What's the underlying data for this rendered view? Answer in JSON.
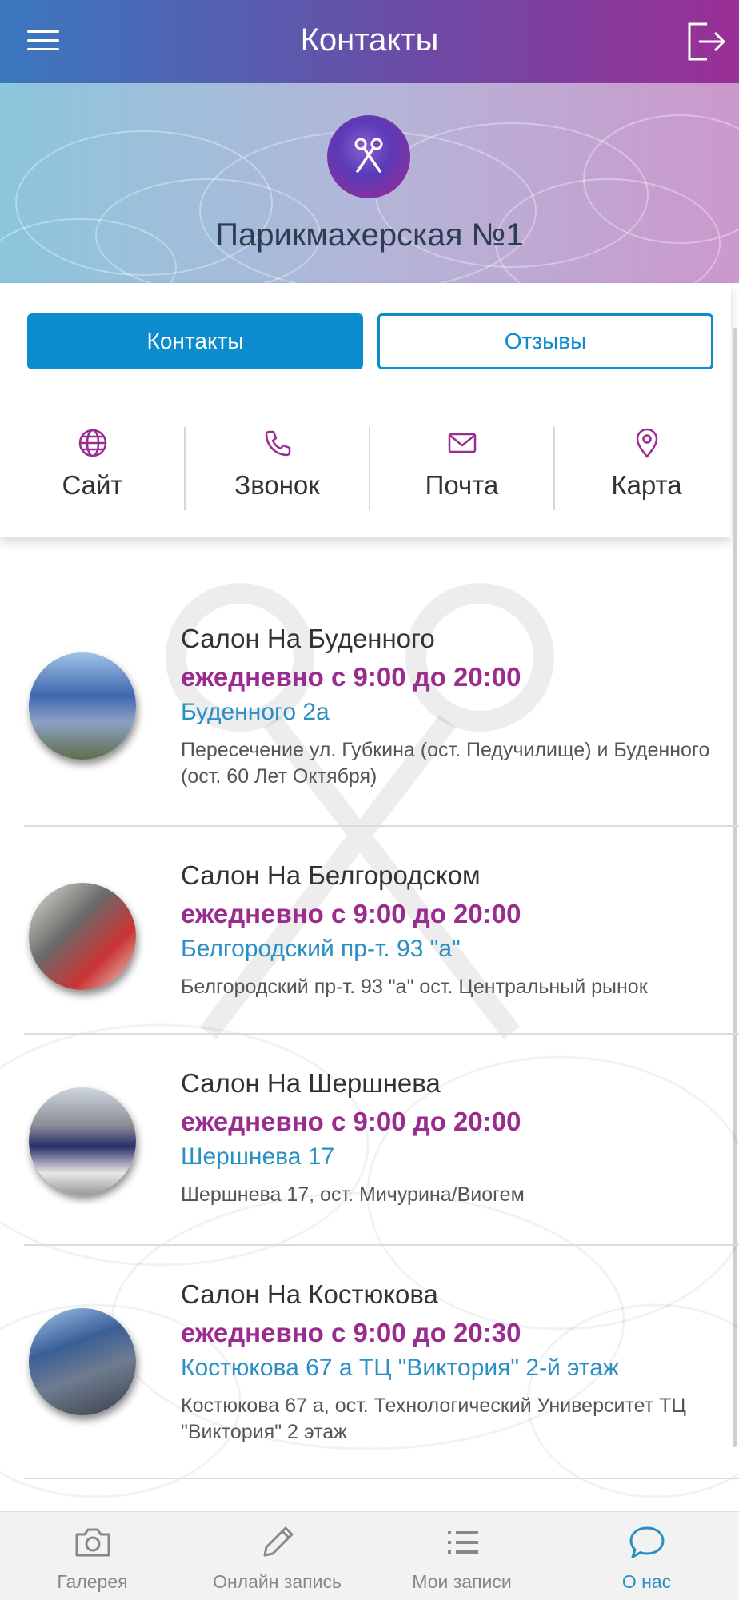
{
  "header": {
    "title": "Контакты"
  },
  "hero": {
    "name": "Парикмахерская №1"
  },
  "tabs": [
    {
      "label": "Контакты",
      "active": true
    },
    {
      "label": "Отзывы",
      "active": false
    }
  ],
  "actions": [
    {
      "label": "Сайт",
      "icon": "globe-icon"
    },
    {
      "label": "Звонок",
      "icon": "phone-icon"
    },
    {
      "label": "Почта",
      "icon": "mail-icon"
    },
    {
      "label": "Карта",
      "icon": "map-pin-icon"
    }
  ],
  "salons": [
    {
      "name": "Салон На Буденного",
      "hours": "ежедневно с 9:00 до 20:00",
      "address": "Буденного 2а",
      "description": "Пересечение ул. Губкина (ост. Педучилище) и Буденного (ост. 60 Лет Октября)"
    },
    {
      "name": "Салон На Белгородском",
      "hours": "ежедневно с 9:00 до 20:00",
      "address": "Белгородский пр-т. 93 \"а\"",
      "description": "Белгородский пр-т. 93 \"а\" ост. Центральный рынок"
    },
    {
      "name": "Салон На Шершнева",
      "hours": "ежедневно с 9:00 до 20:00",
      "address": "Шершнева 17",
      "description": "Шершнева 17, ост. Мичурина/Виогем"
    },
    {
      "name": "Салон На Костюкова",
      "hours": "ежедневно с 9:00 до 20:30",
      "address": "Костюкова 67 а ТЦ \"Виктория\" 2-й этаж",
      "description": "Костюкова 67 а, ост. Технологический Университет ТЦ \"Виктория\" 2 этаж"
    }
  ],
  "bottom_nav": [
    {
      "label": "Галерея",
      "icon": "camera-icon",
      "active": false
    },
    {
      "label": "Онлайн запись",
      "icon": "pencil-icon",
      "active": false
    },
    {
      "label": "Мои записи",
      "icon": "list-icon",
      "active": false
    },
    {
      "label": "О нас",
      "icon": "chat-bubble-icon",
      "active": true
    }
  ],
  "colors": {
    "accent": "#0c8ccd",
    "hours": "#9b2c8f",
    "address": "#2a8fc4",
    "header_start": "#3a78bf",
    "header_end": "#9a2f96"
  }
}
